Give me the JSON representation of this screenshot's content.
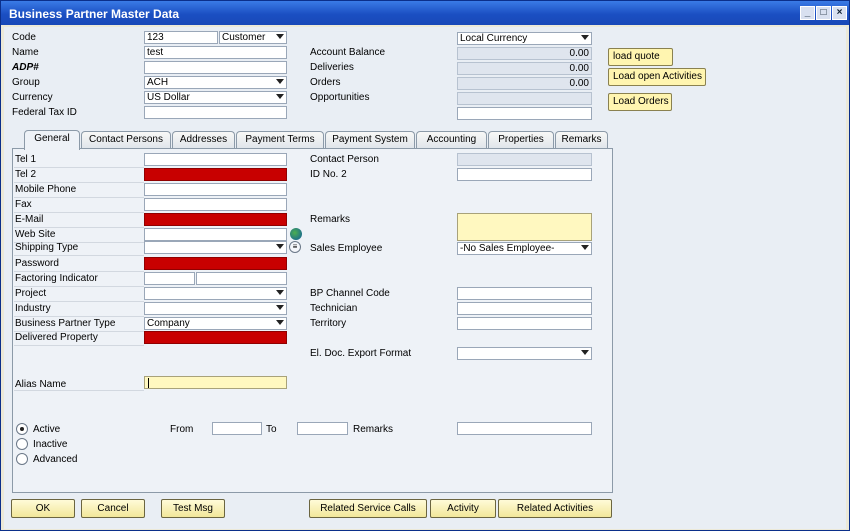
{
  "window": {
    "title": "Business Partner Master Data"
  },
  "header": {
    "code_label": "Code",
    "code_value": "123",
    "type_value": "Customer",
    "name_label": "Name",
    "name_value": "test",
    "adp_label": "ADP#",
    "group_label": "Group",
    "group_value": "ACH",
    "currency_label": "Currency",
    "currency_value": "US Dollar",
    "taxid_label": "Federal Tax ID",
    "local_currency": "Local Currency",
    "account_balance_label": "Account Balance",
    "account_balance_value": "0.00",
    "deliveries_label": "Deliveries",
    "deliveries_value": "0.00",
    "orders_label": "Orders",
    "orders_value": "0.00",
    "opportunities_label": "Opportunities"
  },
  "side_buttons": {
    "load_quote": "load quote",
    "load_activities": "Load open Activities",
    "load_orders": "Load Orders"
  },
  "tabs": [
    "General",
    "Contact Persons",
    "Addresses",
    "Payment Terms",
    "Payment System",
    "Accounting",
    "Properties",
    "Remarks"
  ],
  "general": {
    "tel1": "Tel 1",
    "tel2": "Tel 2",
    "mobile": "Mobile Phone",
    "fax": "Fax",
    "email": "E-Mail",
    "website": "Web Site",
    "shipping": "Shipping Type",
    "password": "Password",
    "factoring": "Factoring Indicator",
    "project": "Project",
    "industry": "Industry",
    "bp_type": "Business Partner Type",
    "bp_type_value": "Company",
    "delivered": "Delivered Property",
    "contact_person": "Contact Person",
    "id_no2": "ID No. 2",
    "remarks": "Remarks",
    "sales_employee": "Sales Employee",
    "sales_employee_value": "-No Sales Employee-",
    "bp_channel": "BP Channel Code",
    "technician": "Technician",
    "territory": "Territory",
    "eldoc": "El. Doc. Export Format",
    "alias": "Alias Name",
    "active": "Active",
    "inactive": "Inactive",
    "advanced": "Advanced",
    "from": "From",
    "to": "To",
    "remarks2": "Remarks"
  },
  "footer": {
    "ok": "OK",
    "cancel": "Cancel",
    "test_msg": "Test Msg",
    "related_service_calls": "Related Service Calls",
    "activity": "Activity",
    "related_activities": "Related Activities"
  }
}
